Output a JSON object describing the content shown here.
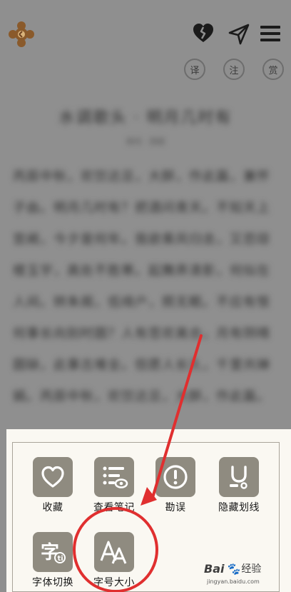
{
  "header": {
    "mini_tabs": [
      "译",
      "注",
      "赏"
    ]
  },
  "article": {
    "title": "水调歌头 · 明月几时有",
    "meta": "宋代 · 苏轼",
    "lines": [
      "丙辰中秋，欢饮达旦，大醉，作此篇，兼怀",
      "子由。明月几时有？把酒问青天。不知天上",
      "宫阙，今夕是何年。我欲乘风归去，又恐琼",
      "楼玉宇，高处不胜寒。起舞弄清影，何似在",
      "人间。转朱阁，低绮户，照无眠。不应有恨",
      "何事长向别时圆？人有悲欢离合，月有阴晴",
      "圆缺，此事古难全。但愿人长久，千里共婵",
      "娟。丙辰中秋，欢饮达旦，大醉，作此篇。"
    ]
  },
  "panel": {
    "actions": [
      {
        "id": "favorite",
        "label": "收藏",
        "icon": "heart-outline-icon"
      },
      {
        "id": "notes",
        "label": "查看笔记",
        "icon": "notes-list-icon"
      },
      {
        "id": "report",
        "label": "勘误",
        "icon": "exclamation-circle-icon"
      },
      {
        "id": "hide-underline",
        "label": "隐藏划线",
        "icon": "magnet-underline-icon"
      },
      {
        "id": "font-switch",
        "label": "字体切换",
        "icon": "font-switch-icon"
      },
      {
        "id": "font-size",
        "label": "字号大小",
        "icon": "font-size-aa-icon"
      }
    ]
  },
  "annotation": {
    "color": "#e02f2f"
  },
  "watermark": {
    "brand": "Bai",
    "suffix": "经验",
    "domain": "jingyan.baidu.com"
  }
}
